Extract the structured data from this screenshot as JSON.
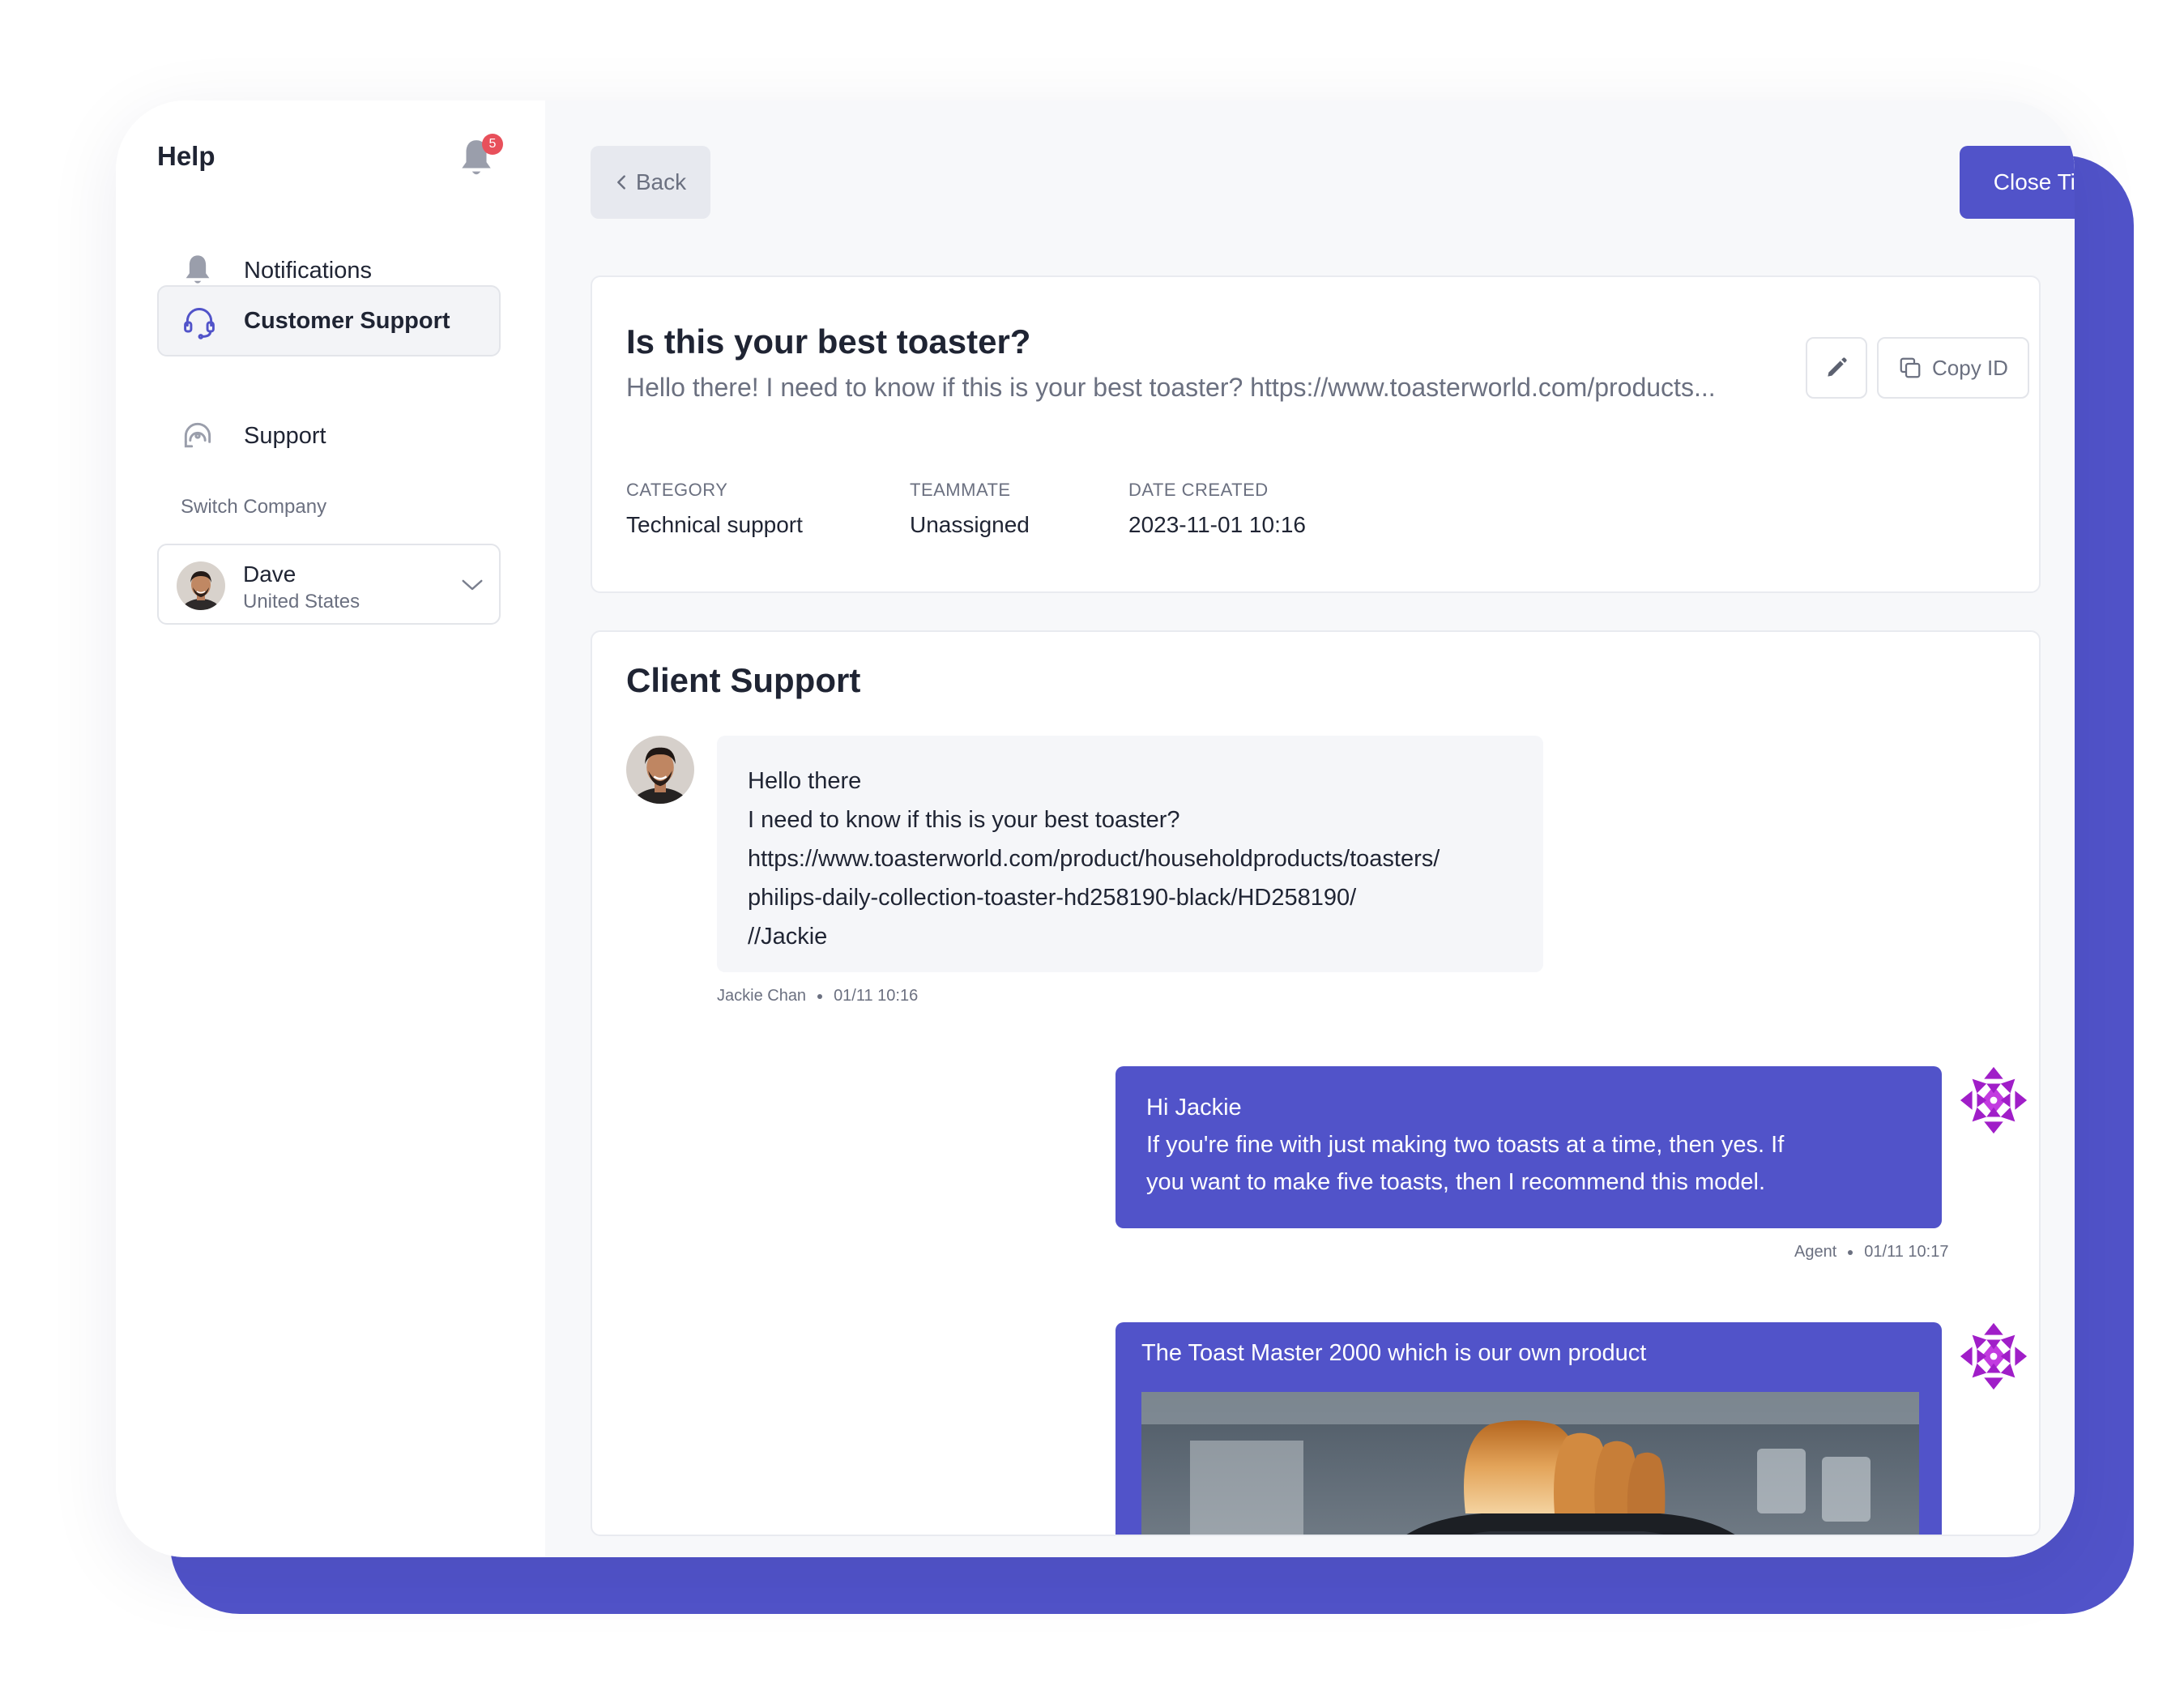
{
  "sidebar": {
    "title": "Help",
    "notification_count": "5",
    "items": [
      {
        "label": "Notifications",
        "icon": "bell-icon",
        "active": false
      },
      {
        "label": "Customer Support",
        "icon": "headset-icon",
        "active": true
      },
      {
        "label": "Support",
        "icon": "support-agent-icon",
        "active": false
      }
    ],
    "switch_company_label": "Switch Company",
    "company": {
      "name": "Dave",
      "country": "United States"
    }
  },
  "toolbar": {
    "back_label": "Back",
    "close_label": "Close Ticket"
  },
  "ticket": {
    "title": "Is this your best toaster?",
    "preview": "Hello there! I need to know if this is your best toaster? https://www.toasterworld.com/products...",
    "copy_id_label": "Copy ID",
    "meta": [
      {
        "label": "CATEGORY",
        "value": "Technical support"
      },
      {
        "label": "TEAMMATE",
        "value": "Unassigned"
      },
      {
        "label": "DATE CREATED",
        "value": "2023-11-01 10:16"
      }
    ]
  },
  "chat": {
    "title": "Client Support",
    "messages": [
      {
        "from": "client",
        "lines": [
          "Hello there",
          "I need to know if this is your best toaster?",
          "https://www.toasterworld.com/product/householdproducts/toasters/",
          "philips-daily-collection-toaster-hd258190-black/HD258190/",
          "//Jackie"
        ],
        "author": "Jackie Chan",
        "time": "01/11 10:16"
      },
      {
        "from": "agent",
        "lines": [
          "Hi Jackie",
          "If you're fine with just making two toasts at a time, then yes. If",
          "you want to make five toasts, then I recommend this model."
        ],
        "author": "Agent",
        "time": "01/11 10:17"
      },
      {
        "from": "agent",
        "caption": "The Toast Master 2000 which is our own product"
      }
    ]
  },
  "colors": {
    "accent": "#5153c9",
    "badge": "#e8505b",
    "muted_text": "#6b7080",
    "border": "#e3e5ea"
  }
}
